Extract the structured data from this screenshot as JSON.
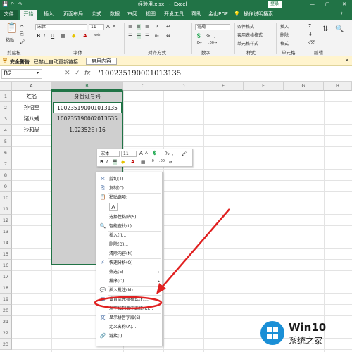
{
  "titlebar": {
    "filename": "经验用.xlsx",
    "app": "Excel",
    "login_label": "登录",
    "minimize": "—",
    "restore": "▢",
    "close": "✕"
  },
  "tabs": [
    "文件",
    "开始",
    "插入",
    "页面布局",
    "公式",
    "数据",
    "审阅",
    "视图",
    "开发工具",
    "帮助",
    "金山PDF",
    "操作说明搜索"
  ],
  "ribbon": {
    "clipboard": {
      "label": "剪贴板",
      "paste": "粘贴"
    },
    "font": {
      "label": "字体",
      "font_name": "宋体",
      "font_size": "11",
      "grow": "A",
      "shrink": "A",
      "wen": "wén",
      "bold": "B",
      "italic": "I",
      "underline": "U"
    },
    "alignment": {
      "label": "对齐方式"
    },
    "number": {
      "label": "数字",
      "format": "常规",
      "percent": "%",
      "comma": ","
    },
    "styles": {
      "label": "样式",
      "items": [
        "条件格式",
        "套用表格格式",
        "单元格样式"
      ]
    },
    "cells": {
      "label": "单元格",
      "items": [
        "插入",
        "删除",
        "格式"
      ]
    },
    "editing": {
      "label": "编辑",
      "sigma": "Σ"
    }
  },
  "warning": {
    "icon": "⛨",
    "title": "安全警告",
    "message": "已禁止自动更新链接",
    "button": "启用内容"
  },
  "formula_bar": {
    "namebox": "B2",
    "cancel": "✕",
    "enter": "✓",
    "fx": "fx",
    "content": "'100235190001013135"
  },
  "grid": {
    "columns": [
      "A",
      "B",
      "C",
      "D",
      "E",
      "F",
      "G",
      "H"
    ],
    "rows": [
      "1",
      "2",
      "3",
      "4",
      "5",
      "6",
      "7",
      "8",
      "9",
      "10",
      "11",
      "12",
      "13",
      "14",
      "15",
      "16",
      "17",
      "18",
      "19",
      "20",
      "21",
      "22",
      "23"
    ],
    "cells": {
      "A1": "姓名",
      "B1": "身份证号码",
      "A2": "孙悟空",
      "B2": "100235190001013135",
      "A3": "猪八戒",
      "B3": "100235190002013635",
      "A4": "沙和尚",
      "B4": "1.02352E+16"
    }
  },
  "mini_toolbar": {
    "font_name": "宋体",
    "font_size": "11",
    "grow": "A",
    "shrink": "A",
    "format": "💲",
    "percent": "%",
    "comma": ",",
    "bold": "B",
    "italic": "I"
  },
  "context_menu": {
    "items": [
      {
        "icon": "✂",
        "label": "剪切(T)"
      },
      {
        "icon": "⎘",
        "label": "复制(C)"
      },
      {
        "icon": "📋",
        "label": "粘贴选项:"
      },
      {
        "icon": "A",
        "label": ""
      },
      {
        "icon": "",
        "label": "选择性粘贴(S)..."
      },
      {
        "icon": "🔍",
        "label": "智能查找(L)"
      },
      {
        "icon": "",
        "label": "插入(I)..."
      },
      {
        "icon": "",
        "label": "删除(D)..."
      },
      {
        "icon": "",
        "label": "清除内容(N)"
      },
      {
        "icon": "⚡",
        "label": "快速分析(Q)"
      },
      {
        "icon": "",
        "label": "筛选(E)"
      },
      {
        "icon": "",
        "label": "排序(O)"
      },
      {
        "icon": "💬",
        "label": "插入批注(M)"
      },
      {
        "icon": "▦",
        "label": "设置单元格格式(F)..."
      },
      {
        "icon": "",
        "label": "从下拉列表中选择(K)..."
      },
      {
        "icon": "文",
        "label": "显示拼音字段(S)"
      },
      {
        "icon": "",
        "label": "定义名称(A)..."
      },
      {
        "icon": "🔗",
        "label": "链接(I)"
      }
    ]
  },
  "watermark": {
    "line1": "Win10",
    "line2": "系统之家"
  },
  "colors": {
    "excel_green": "#217346",
    "highlight_red": "#e02020",
    "selection_gray": "#cfcfcf"
  }
}
